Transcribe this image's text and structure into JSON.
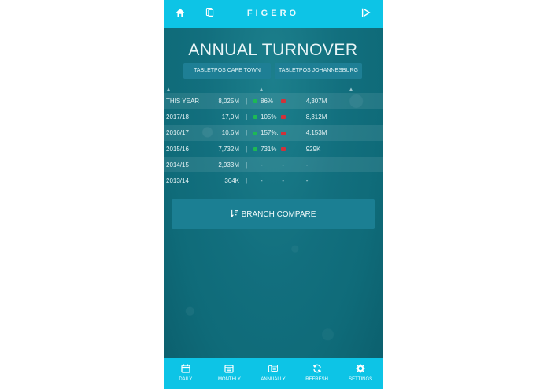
{
  "header": {
    "brand": "FIGERO",
    "home_icon": "home-icon",
    "tablet_icon": "tablet-icon",
    "logout_icon": "logout-icon"
  },
  "page": {
    "title": "ANNUAL TURNOVER"
  },
  "tabs": [
    {
      "label": "TABLETPOS CAPE TOWN"
    },
    {
      "label": "TABLETPOS JOHANNESBURG"
    }
  ],
  "rows": [
    {
      "label": "THIS YEAR",
      "value": "8,025M",
      "pct": "86%",
      "trend": "up",
      "right": "4,307M"
    },
    {
      "label": "2017/18",
      "value": "17,0M",
      "pct": "105%",
      "trend": "up",
      "right": "8,312M"
    },
    {
      "label": "2016/17",
      "value": "10,6M",
      "pct": "157%,",
      "trend": "up",
      "right": "4,153M"
    },
    {
      "label": "2015/16",
      "value": "7,732M",
      "pct": "731%",
      "trend": "up",
      "right": "929K"
    },
    {
      "label": "2014/15",
      "value": "2,933M",
      "pct": "-",
      "trend": "none",
      "right": "-"
    },
    {
      "label": "2013/14",
      "value": "364K",
      "pct": "-",
      "trend": "none",
      "right": "-"
    }
  ],
  "symbols": {
    "separator": "|",
    "dash": "-"
  },
  "compare_button": {
    "label": "BRANCH COMPARE",
    "icon": "sort-icon"
  },
  "bottom_nav": [
    {
      "label": "DAILY",
      "icon": "calendar-day-icon"
    },
    {
      "label": "MONTHLY",
      "icon": "calendar-month-icon"
    },
    {
      "label": "ANNUALLY",
      "icon": "calendar-year-icon"
    },
    {
      "label": "REFRESH",
      "icon": "refresh-icon"
    },
    {
      "label": "SETTINGS",
      "icon": "gear-icon"
    }
  ],
  "colors": {
    "topbar": "#0dc4e6",
    "background": "#126f7e",
    "up": "#1db954",
    "down": "#d0323a"
  }
}
